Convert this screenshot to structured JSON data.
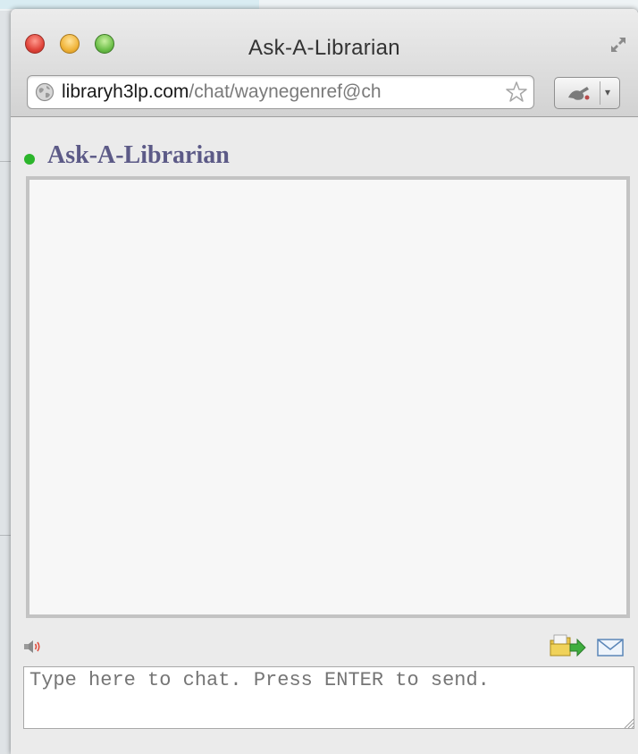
{
  "window": {
    "title": "Ask-A-Librarian"
  },
  "address_bar": {
    "url_domain": "libraryh3lp.com",
    "url_path": "/chat/waynegenref@ch"
  },
  "chat": {
    "status": "online",
    "title": "Ask-A-Librarian",
    "input_placeholder": "Type here to chat. Press ENTER to send.",
    "input_value": ""
  },
  "colors": {
    "status_online": "#2bb52b",
    "title_text": "#5c5a87"
  },
  "icons": {
    "window_controls": [
      "close-icon",
      "minimize-icon",
      "zoom-icon"
    ],
    "fullscreen": "fullscreen-icon",
    "address_site": "globe-icon",
    "bookmark": "star-icon",
    "extension": "extension-icon",
    "sound": "speaker-icon",
    "send_file": "send-file-icon",
    "email": "email-icon"
  }
}
